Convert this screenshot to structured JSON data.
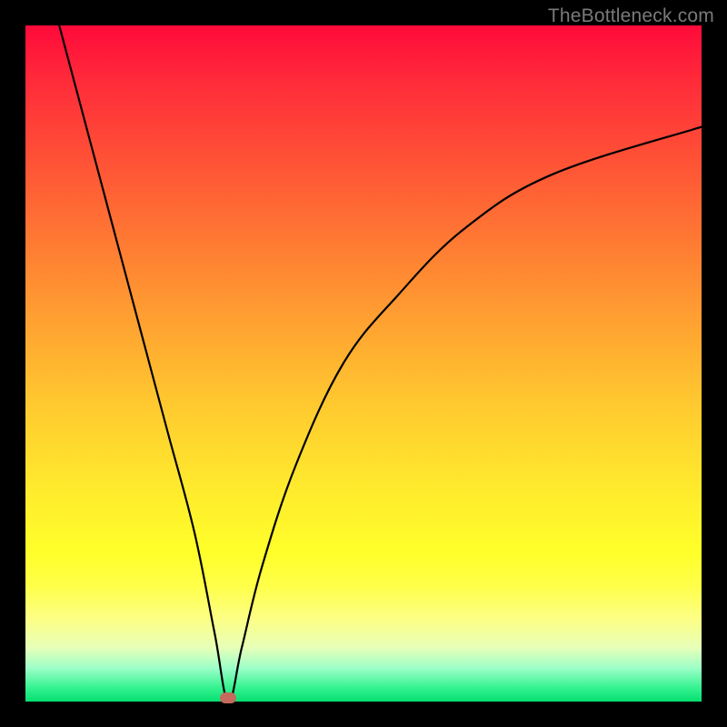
{
  "attribution": "TheBottleneck.com",
  "chart_data": {
    "type": "line",
    "title": "",
    "xlabel": "",
    "ylabel": "",
    "categories": [],
    "xlim": [
      0,
      100
    ],
    "ylim": [
      0,
      100
    ],
    "marker": {
      "x": 30,
      "y": 0
    },
    "series": [
      {
        "name": "curve",
        "points": [
          {
            "x": 5,
            "y": 100
          },
          {
            "x": 9,
            "y": 85
          },
          {
            "x": 13,
            "y": 70
          },
          {
            "x": 17,
            "y": 55
          },
          {
            "x": 21,
            "y": 40
          },
          {
            "x": 25,
            "y": 25
          },
          {
            "x": 28,
            "y": 10
          },
          {
            "x": 30,
            "y": 0
          },
          {
            "x": 32,
            "y": 8
          },
          {
            "x": 35,
            "y": 20
          },
          {
            "x": 40,
            "y": 35
          },
          {
            "x": 47,
            "y": 50
          },
          {
            "x": 55,
            "y": 60
          },
          {
            "x": 65,
            "y": 70
          },
          {
            "x": 78,
            "y": 78
          },
          {
            "x": 100,
            "y": 85
          }
        ]
      }
    ]
  }
}
